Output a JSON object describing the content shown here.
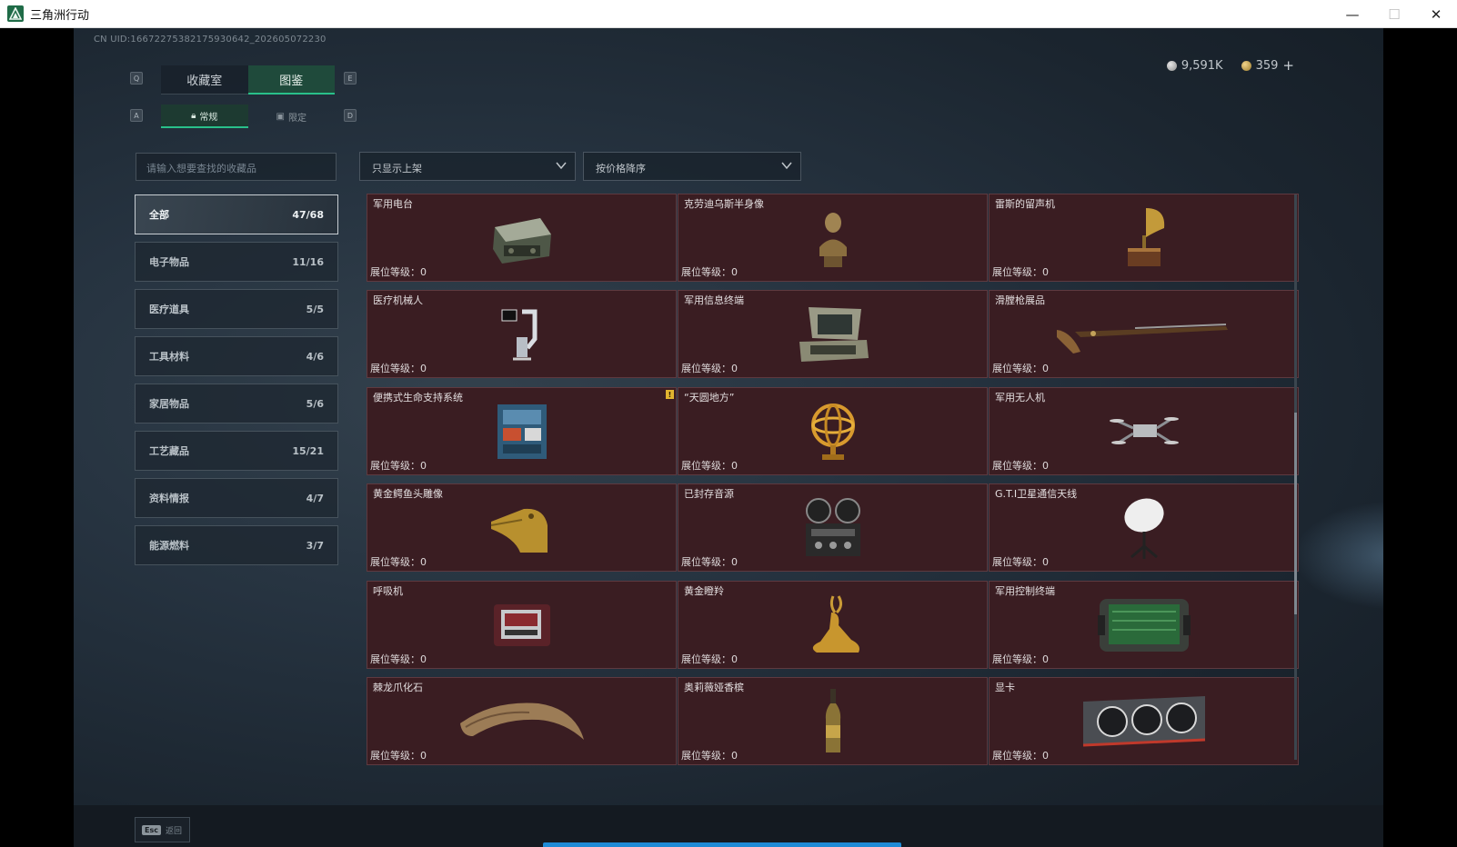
{
  "window": {
    "title": "三角洲行动",
    "min": "—",
    "max": "☐",
    "close": "✕"
  },
  "uid": "CN UID:166722753821759306​42_202605072230",
  "currency": {
    "silver": "9,591K",
    "gold": "359",
    "plus": "+"
  },
  "hotkeys": {
    "prev_tab": "Q",
    "next_tab": "E",
    "prev_sub": "A",
    "next_sub": "D"
  },
  "main_tabs": [
    "收藏室",
    "图鉴"
  ],
  "sub_tabs": [
    "常规",
    "限定"
  ],
  "search": {
    "placeholder": "请输入想要查找的收藏品"
  },
  "filters": {
    "shelf": "只显示上架",
    "sort": "按价格降序"
  },
  "categories": [
    {
      "label": "全部",
      "count": "47/68"
    },
    {
      "label": "电子物品",
      "count": "11/16"
    },
    {
      "label": "医疗道具",
      "count": "5/5"
    },
    {
      "label": "工具材料",
      "count": "4/6"
    },
    {
      "label": "家居物品",
      "count": "5/6"
    },
    {
      "label": "工艺藏品",
      "count": "15/21"
    },
    {
      "label": "资料情报",
      "count": "4/7"
    },
    {
      "label": "能源燃料",
      "count": "3/7"
    }
  ],
  "level_label": "展位等级：",
  "items": [
    {
      "name": "军用电台",
      "level": "0",
      "icon": "radio-icon"
    },
    {
      "name": "克劳迪乌斯半身像",
      "level": "0",
      "icon": "bust-icon"
    },
    {
      "name": "雷斯的留声机",
      "level": "0",
      "icon": "gramophone-icon"
    },
    {
      "name": "医疗机械人",
      "level": "0",
      "icon": "medical-robot-icon"
    },
    {
      "name": "军用信息终端",
      "level": "0",
      "icon": "info-terminal-icon"
    },
    {
      "name": "滑膛枪展品",
      "level": "0",
      "icon": "musket-icon"
    },
    {
      "name": "便携式生命支持系统",
      "level": "0",
      "icon": "life-support-icon",
      "badge": "!"
    },
    {
      "name": "“天圆地方”",
      "level": "0",
      "icon": "armillary-sphere-icon"
    },
    {
      "name": "军用无人机",
      "level": "0",
      "icon": "drone-icon"
    },
    {
      "name": "黄金鳄鱼头雕像",
      "level": "0",
      "icon": "crocodile-head-icon"
    },
    {
      "name": "已封存音源",
      "level": "0",
      "icon": "reel-recorder-icon"
    },
    {
      "name": "G.T.I卫星通信天线",
      "level": "0",
      "icon": "satellite-dish-icon"
    },
    {
      "name": "呼吸机",
      "level": "0",
      "icon": "ventilator-icon"
    },
    {
      "name": "黄金瞪羚",
      "level": "0",
      "icon": "gazelle-icon"
    },
    {
      "name": "军用控制终端",
      "level": "0",
      "icon": "control-terminal-icon"
    },
    {
      "name": "棘龙爪化石",
      "level": "0",
      "icon": "claw-fossil-icon"
    },
    {
      "name": "奥莉薇娅香槟",
      "level": "0",
      "icon": "champagne-icon"
    },
    {
      "name": "显卡",
      "level": "0",
      "icon": "graphics-card-icon"
    }
  ],
  "esc": {
    "key": "Esc",
    "label": "返回"
  },
  "colors": {
    "accent": "#29c08a",
    "card_bg": "#3a1d22",
    "progress": "#1e8bd6"
  }
}
